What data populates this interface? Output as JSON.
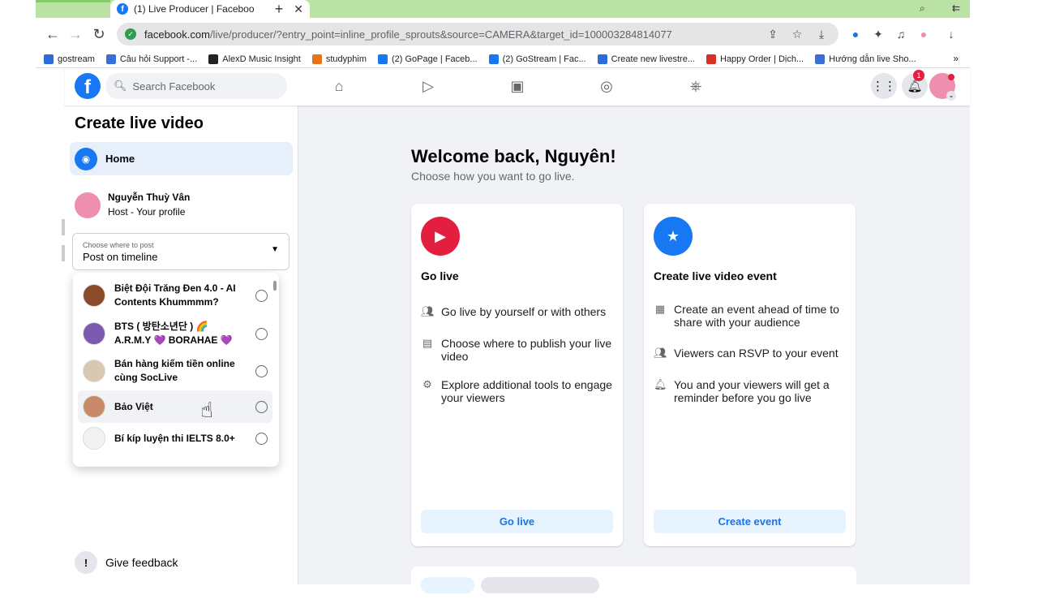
{
  "browser": {
    "tab_title": "(1) Live Producer | Faceboo",
    "url_domain": "facebook.com",
    "url_path": "/live/producer/?entry_point=inline_profile_sprouts&source=CAMERA&target_id=100003284814077",
    "bookmarks": [
      {
        "label": "gostream",
        "color": "#2b6cd6"
      },
      {
        "label": "Câu hỏi Support -...",
        "color": "#3b6fd8"
      },
      {
        "label": "AlexD Music Insight",
        "color": "#222222"
      },
      {
        "label": "studyphim",
        "color": "#e8711a"
      },
      {
        "label": "(2) GoPage | Faceb...",
        "color": "#1877f2"
      },
      {
        "label": "(2) GoStream | Fac...",
        "color": "#1877f2"
      },
      {
        "label": "Create new livestre...",
        "color": "#2b6cd6"
      },
      {
        "label": "Happy Order | Dịch...",
        "color": "#d93025"
      },
      {
        "label": "Hướng dẫn live Sho...",
        "color": "#3b6fd8"
      }
    ],
    "bookmarks_more": "»"
  },
  "fb": {
    "search_placeholder": "Search Facebook",
    "notif_count": "1"
  },
  "sidebar": {
    "title": "Create live video",
    "home_label": "Home",
    "host_name": "Nguyễn Thuỳ Vân",
    "host_role": "Host - Your profile",
    "select_label": "Choose where to post",
    "select_value": "Post on timeline",
    "feedback_label": "Give feedback"
  },
  "dropdown_items": [
    {
      "label": "Biệt Đội Trăng Đen 4.0 - AI Contents Khummmm?",
      "color": "#8a4b2a"
    },
    {
      "label": "BTS ( 방탄소년단 ) 🌈 A.R.M.Y 💜 BORAHAE 💜",
      "color": "#7b5ab0"
    },
    {
      "label": "Bán hàng kiếm tiền online cùng SocLive",
      "color": "#d8c8b0"
    },
    {
      "label": "Bảo Việt",
      "color": "#c98a6a"
    },
    {
      "label": "Bí kíp luyện thi IELTS 8.0+",
      "color": "#f2f2f2"
    }
  ],
  "main": {
    "welcome": "Welcome back, Nguyên!",
    "subtitle": "Choose how you want to go live.",
    "golive": {
      "title": "Go live",
      "features": [
        "Go live by yourself or with others",
        "Choose where to publish your live video",
        "Explore additional tools to engage your viewers"
      ],
      "button": "Go live",
      "icon_color": "#e41e3f"
    },
    "event": {
      "title": "Create live video event",
      "features": [
        "Create an event ahead of time to share with your audience",
        "Viewers can RSVP to your event",
        "You and your viewers will get a reminder before you go live"
      ],
      "button": "Create event",
      "icon_color": "#1877f2"
    }
  }
}
